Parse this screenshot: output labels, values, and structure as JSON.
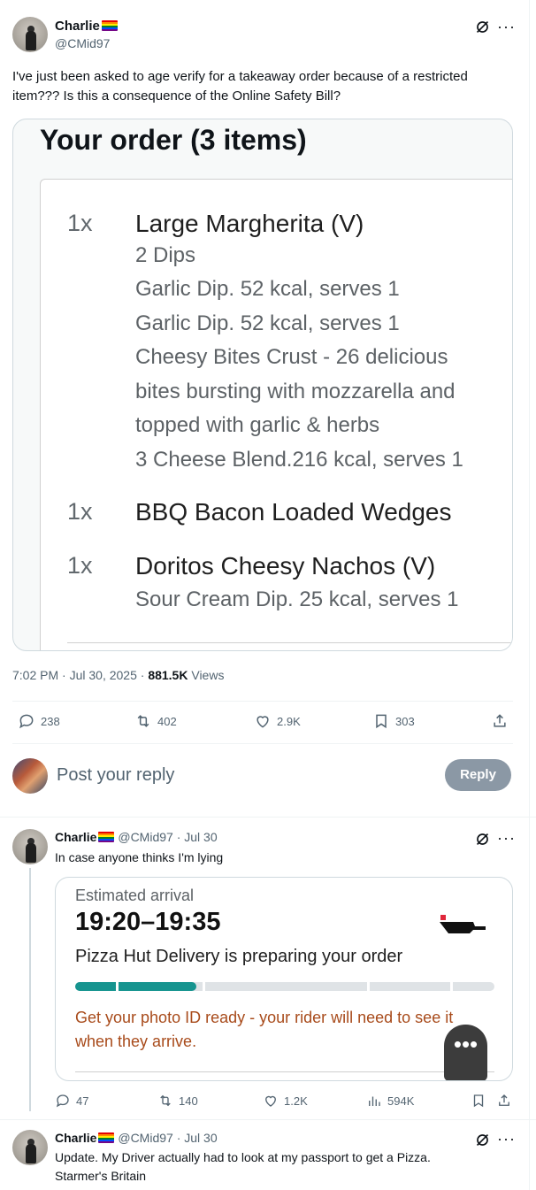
{
  "tweet": {
    "author_name": "Charlie",
    "author_handle": "@CMid97",
    "text": "I've just been asked to age verify for a takeaway order because of a restricted item??? Is this a consequence of the Online Safety Bill?",
    "icons": [
      "grok-icon",
      "more-icon"
    ],
    "media": {
      "title": "Your order (3 items)",
      "items": [
        {
          "qty": "1x",
          "name": "Large Margherita (V)",
          "details": [
            "2 Dips",
            "Garlic Dip. 52 kcal, serves 1",
            "Garlic Dip. 52 kcal, serves 1",
            "Cheesy Bites Crust - 26 delicious",
            "bites bursting with mozzarella and",
            "topped with garlic & herbs",
            "3 Cheese Blend.216 kcal, serves 1"
          ]
        },
        {
          "qty": "1x",
          "name": "BBQ Bacon Loaded Wedges",
          "details": []
        },
        {
          "qty": "1x",
          "name": "Doritos Cheesy Nachos (V)",
          "details": [
            "Sour Cream Dip. 25 kcal, serves 1"
          ]
        }
      ]
    },
    "timestamp": "7:02 PM · Jul 30, 2025 · ",
    "views_count": "881.5K",
    "views_label": " Views",
    "actions": {
      "replies": "238",
      "reposts": "402",
      "likes": "2.9K",
      "bookmarks": "303"
    }
  },
  "composer": {
    "placeholder": "Post your reply",
    "reply_label": "Reply"
  },
  "reply1": {
    "author_name": "Charlie",
    "handle_date": "@CMid97 · Jul 30",
    "text": "In case anyone thinks I'm lying",
    "media": {
      "label": "Estimated arrival",
      "time": "19:20–19:35",
      "status": "Pizza Hut Delivery is preparing your order",
      "progress_fraction": 0.29,
      "notice_line1": "Get your photo ID ready - your rider will need to see it",
      "notice_line2": "when they arrive.",
      "accent_color": "#16948f",
      "notice_color": "#a84b1b",
      "more_button": "•••"
    },
    "actions": {
      "replies": "47",
      "reposts": "140",
      "likes": "1.2K",
      "views": "594K"
    }
  },
  "reply2": {
    "author_name": "Charlie",
    "handle_date": "@CMid97 · Jul 30",
    "text_line1": "Update. My Driver actually had to look at my passport to get a Pizza.",
    "text_line2": "Starmer's Britain"
  }
}
